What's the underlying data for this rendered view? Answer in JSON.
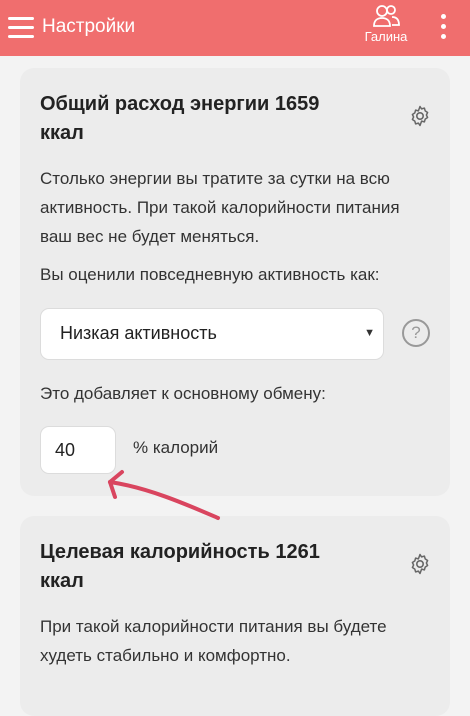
{
  "appbar": {
    "title": "Настройки",
    "user_name": "Галина",
    "icons": {
      "menu": "hamburger-menu-icon",
      "user": "users-icon",
      "more": "more-vertical-icon"
    },
    "color": "#f06e6e"
  },
  "energy_card": {
    "title": "Общий расход энергии 1659 ккал",
    "description": "Столько энергии вы тратите за сутки на всю активность. При такой калорийности питания ваш вес не будет меняться.",
    "activity_label": "Вы оценили повседневную активность как:",
    "activity_value": "Низкая активность",
    "addition_label": "Это добавляет к основному обмену:",
    "addition_value": "40",
    "addition_unit": "% калорий"
  },
  "target_card": {
    "title": "Целевая калорийность 1261 ккал",
    "description": "При такой калорийности питания вы будете худеть стабильно и комфортно."
  }
}
